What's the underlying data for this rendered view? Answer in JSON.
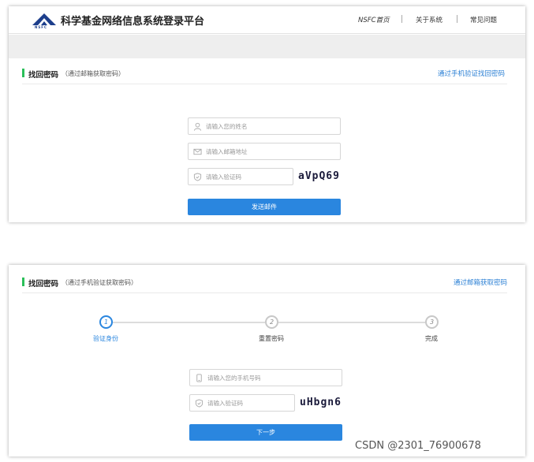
{
  "header": {
    "site_title": "科学基金网络信息系统登录平台",
    "logo_text": "NSFC",
    "nav": [
      "NSFC首页",
      "关于系统",
      "常见问题"
    ]
  },
  "email_recovery": {
    "title": "找回密码",
    "subtitle": "（通过邮箱获取密码）",
    "switch_link": "通过手机验证找回密码",
    "name_placeholder": "请输入您的姓名",
    "email_placeholder": "请输入邮箱地址",
    "code_placeholder": "请输入验证码",
    "captcha_text": "aVpQ69",
    "submit_label": "发送邮件"
  },
  "phone_recovery": {
    "title": "找回密码",
    "subtitle": "（通过手机验证获取密码）",
    "switch_link": "通过邮箱获取密码",
    "steps": [
      {
        "num": "1",
        "label": "验证身份"
      },
      {
        "num": "2",
        "label": "重置密码"
      },
      {
        "num": "3",
        "label": "完成"
      }
    ],
    "current_step": 1,
    "phone_placeholder": "请输入您的手机号码",
    "code_placeholder": "请输入验证码",
    "captcha_text": "uHbgn6",
    "next_label": "下一步"
  },
  "watermark": "CSDN @2301_76900678",
  "colors": {
    "accent": "#2a86df",
    "section_mark": "#2bbf5a",
    "link": "#2a7fd4"
  }
}
